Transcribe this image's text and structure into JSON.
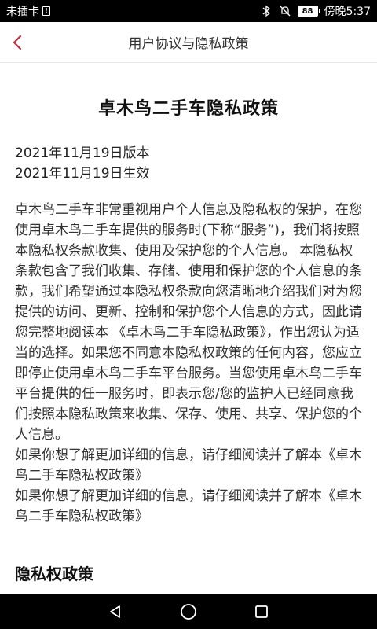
{
  "status_bar": {
    "carrier": "未插卡",
    "battery": "88",
    "time": "傍晚5:37"
  },
  "header": {
    "title": "用户协议与隐私政策",
    "back_icon": "chevron-left-icon",
    "accent_color": "#c0313b"
  },
  "document": {
    "title": "卓木鸟二手车隐私政策",
    "version_line": "2021年11月19日版本",
    "effective_line": "2021年11月19日生效",
    "paragraph": "卓木鸟二手车非常重视用户个人信息及隐私权的保护，在您使用卓木鸟二手车提供的服务时(下称“服务”)，我们将按照本隐私权条款收集、使用及保护您的个人信息。 本隐私权条款包含了我们收集、存储、使用和保护您的个人信息的条款，我们希望通过本隐私权条款向您清晰地介绍我们对为您提供的访问、更新、控制和保护您个人信息的方式，因此请您完整地阅读本 《卓木鸟二手车隐私政策》，作出您认为适当的选择。如果您不同意本隐私权政策的任何内容，您应立即停止使用卓木鸟二手车平台服务。当您使用卓木鸟二手车平台提供的任一服务时，即表示您/您的监护人已经同意我们按照本隐私政策来收集、保存、使用、共享、保护您的个人信息。",
    "more_info_1": "如果你想了解更加详细的信息，请仔细阅读并了解本《卓木鸟二手车隐私权政策》",
    "more_info_2": "如果你想了解更加详细的信息，请仔细阅读并了解本《卓木鸟二手车隐私权政策》",
    "section_heading": "隐私权政策"
  },
  "nav_bar": {
    "back_icon": "triangle-back-icon",
    "home_icon": "circle-home-icon",
    "recents_icon": "square-recents-icon"
  }
}
